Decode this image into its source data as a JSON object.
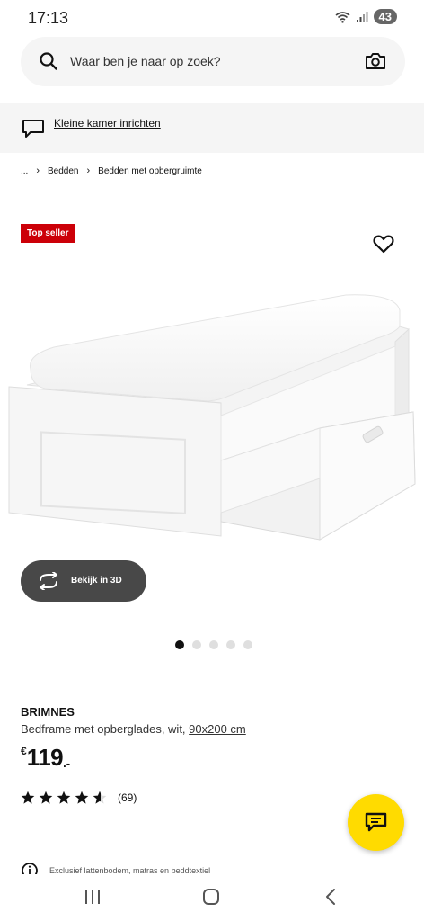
{
  "status_bar": {
    "time": "17:13",
    "battery": "43"
  },
  "search": {
    "placeholder": "Waar ben je naar op zoek?"
  },
  "room_link": {
    "label": "Kleine kamer inrichten"
  },
  "breadcrumb": {
    "ellipsis": "...",
    "items": [
      "Bedden",
      "Bedden met opbergruimte"
    ]
  },
  "badge": {
    "label": "Top seller",
    "color": "#cc0008"
  },
  "view3d": {
    "label": "Bekijk in 3D"
  },
  "carousel": {
    "count": 5,
    "active_index": 0
  },
  "product": {
    "name": "BRIMNES",
    "description": "Bedframe met opberglades, wit, ",
    "size": "90x200 cm",
    "price": {
      "currency": "€",
      "integer": "119",
      "suffix": ".-"
    },
    "rating": {
      "value": 4.5,
      "max": 5,
      "count_label": "(69)"
    }
  },
  "note": {
    "text": "Exclusief lattenbodem, matras en beddtextiel"
  },
  "colors": {
    "accent": "#ffdb00",
    "dark_button": "#484848",
    "panel": "#f5f5f5"
  },
  "icons": [
    "search-icon",
    "camera-icon",
    "chat-outline-icon",
    "heart-icon",
    "rotate-3d-icon",
    "star-icon",
    "chat-icon",
    "info-icon",
    "nav-recents-icon",
    "nav-home-icon",
    "nav-back-icon"
  ]
}
